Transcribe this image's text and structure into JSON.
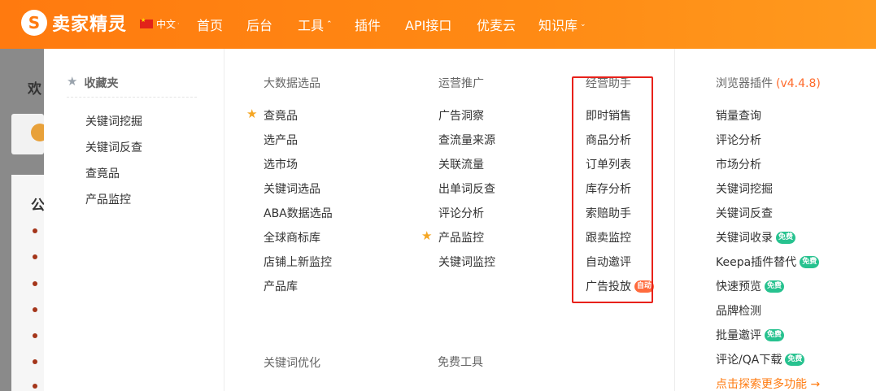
{
  "header": {
    "logo_glyph": "S",
    "logo_text": "卖家精灵",
    "language": "中文",
    "nav": [
      "首页",
      "后台",
      "工具",
      "插件",
      "API接口",
      "优麦云",
      "知识库"
    ]
  },
  "background": {
    "title_fragment": "欢",
    "section_fragment": "公"
  },
  "favorites": {
    "title": "收藏夹",
    "items": [
      "关键词挖掘",
      "关键词反查",
      "查竟品",
      "产品监控"
    ]
  },
  "big_data": {
    "title": "大数据选品",
    "items": [
      "查竟品",
      "选产品",
      "选市场",
      "关键词选品",
      "ABA数据选品",
      "全球商标库",
      "店铺上新监控",
      "产品库"
    ]
  },
  "operations": {
    "title": "运营推广",
    "items": [
      "广告洞察",
      "查流量来源",
      "关联流量",
      "出单词反查",
      "评论分析",
      "产品监控",
      "关键词监控"
    ]
  },
  "assistant": {
    "title": "经营助手",
    "items": [
      "即时销售",
      "商品分析",
      "订单列表",
      "库存分析",
      "索赔助手",
      "跟卖监控",
      "自动邀评",
      "广告投放"
    ],
    "auto_tag": "自动"
  },
  "browser_plugin": {
    "title": "浏览器插件",
    "version": "(v4.4.8)",
    "items": [
      "销量查询",
      "评论分析",
      "市场分析",
      "关键词挖掘",
      "关键词反查",
      "关键词收录",
      "Keepa插件替代",
      "快速预览",
      "品牌检测",
      "批量邀评",
      "评论/QA下载"
    ],
    "free_tag": "免费",
    "more_link": "点击探索更多功能 →"
  },
  "keyword_opt": {
    "title": "关键词优化"
  },
  "free_tools": {
    "title": "免费工具"
  },
  "colors": {
    "header_orange": "#ff7a0f",
    "highlight_box": "#e8211a",
    "free_tag": "#27c28f",
    "auto_tag": "#ff6b3d",
    "pin_star": "#f5a623"
  }
}
